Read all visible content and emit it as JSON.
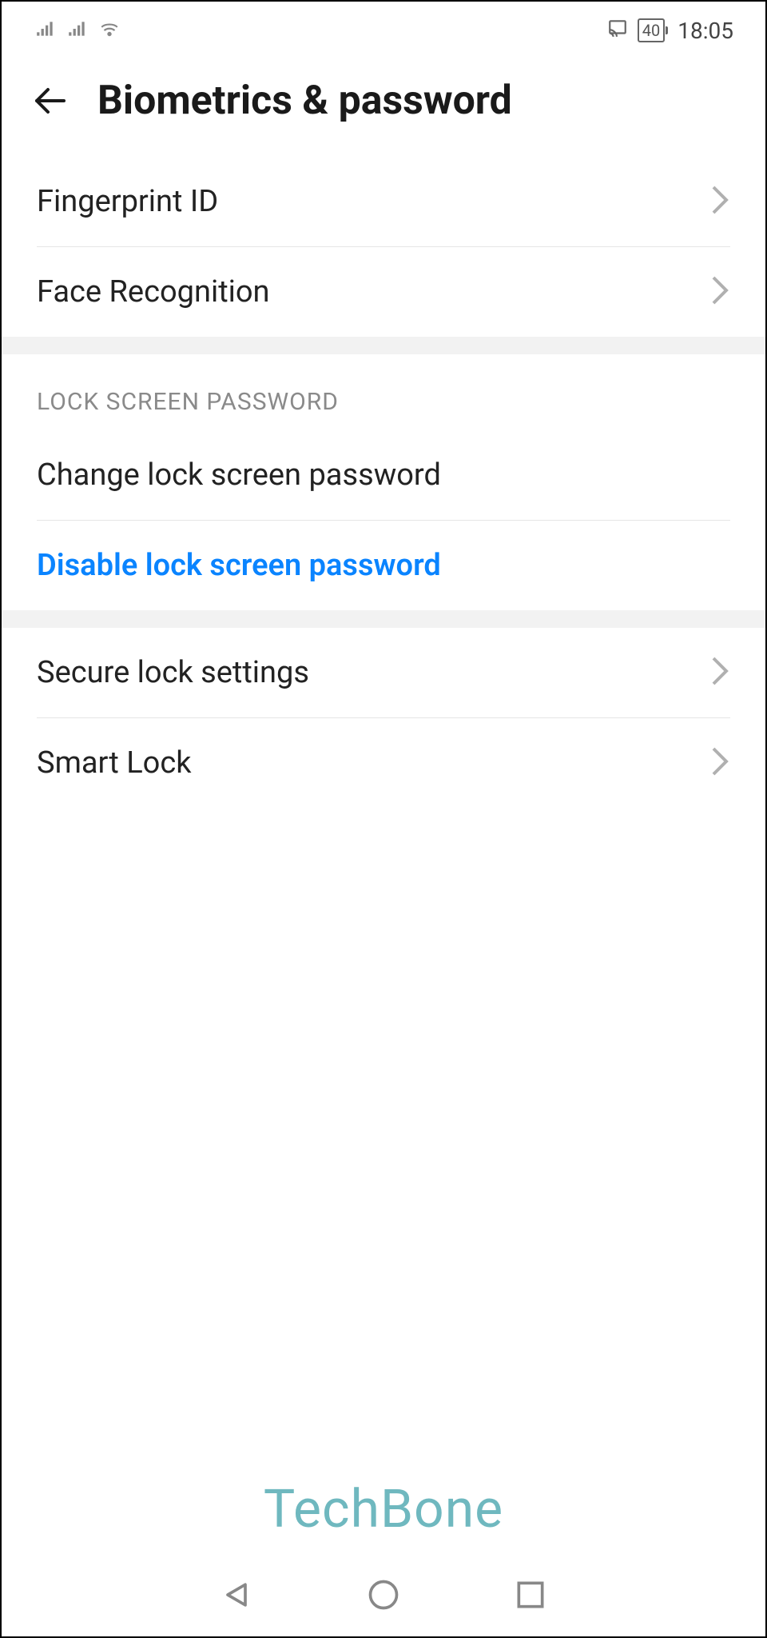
{
  "status": {
    "battery": "40",
    "time": "18:05"
  },
  "header": {
    "title": "Biometrics & password"
  },
  "sections": {
    "biometrics": {
      "fingerprint": "Fingerprint ID",
      "face": "Face Recognition"
    },
    "lock_screen": {
      "header": "LOCK SCREEN PASSWORD",
      "change": "Change lock screen password",
      "disable": "Disable lock screen password"
    },
    "more": {
      "secure_lock": "Secure lock settings",
      "smart_lock": "Smart Lock"
    }
  },
  "watermark": "TechBone"
}
